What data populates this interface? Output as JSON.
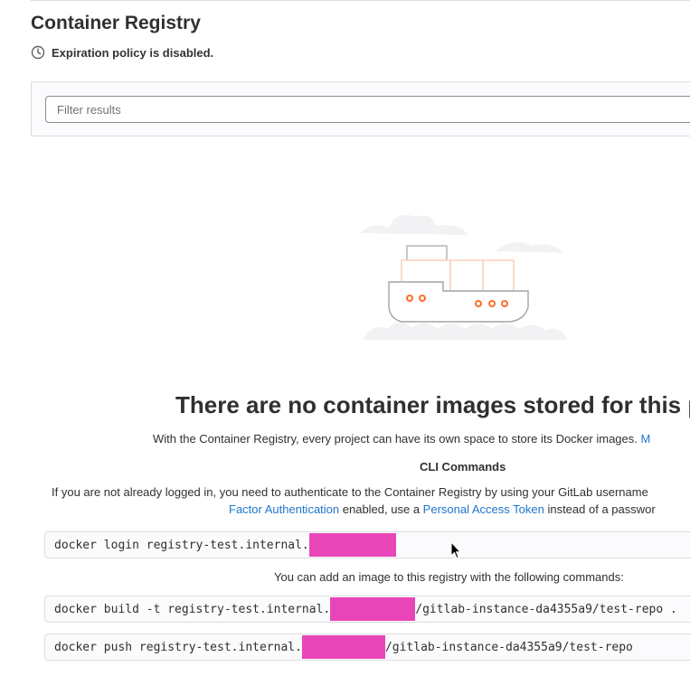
{
  "header": {
    "title": "Container Registry",
    "policy_text": "Expiration policy is disabled."
  },
  "filter": {
    "placeholder": "Filter results"
  },
  "empty_state": {
    "title": "There are no container images stored for this pr",
    "description_prefix": "With the Container Registry, every project can have its own space to store its Docker images.",
    "description_link": "M",
    "cli_title": "CLI Commands",
    "auth_line1": "If you are not already logged in, you need to authenticate to the Container Registry by using your GitLab username",
    "auth_line2_link1": "Factor Authentication",
    "auth_line2_mid": " enabled, use a ",
    "auth_line2_link2": "Personal Access Token",
    "auth_line2_suffix": " instead of a passwor"
  },
  "commands": {
    "login_prefix": "docker login registry-test.internal.",
    "add_image_text": "You can add an image to this registry with the following commands:",
    "build_prefix": "docker build -t registry-test.internal.",
    "build_suffix": "/gitlab-instance-da4355a9/test-repo .",
    "push_prefix": "docker push registry-test.internal.",
    "push_suffix": "/gitlab-instance-da4355a9/test-repo"
  },
  "colors": {
    "link": "#1f75cb",
    "redaction": "#e846b8",
    "illustration_accent": "#fc6d26"
  }
}
